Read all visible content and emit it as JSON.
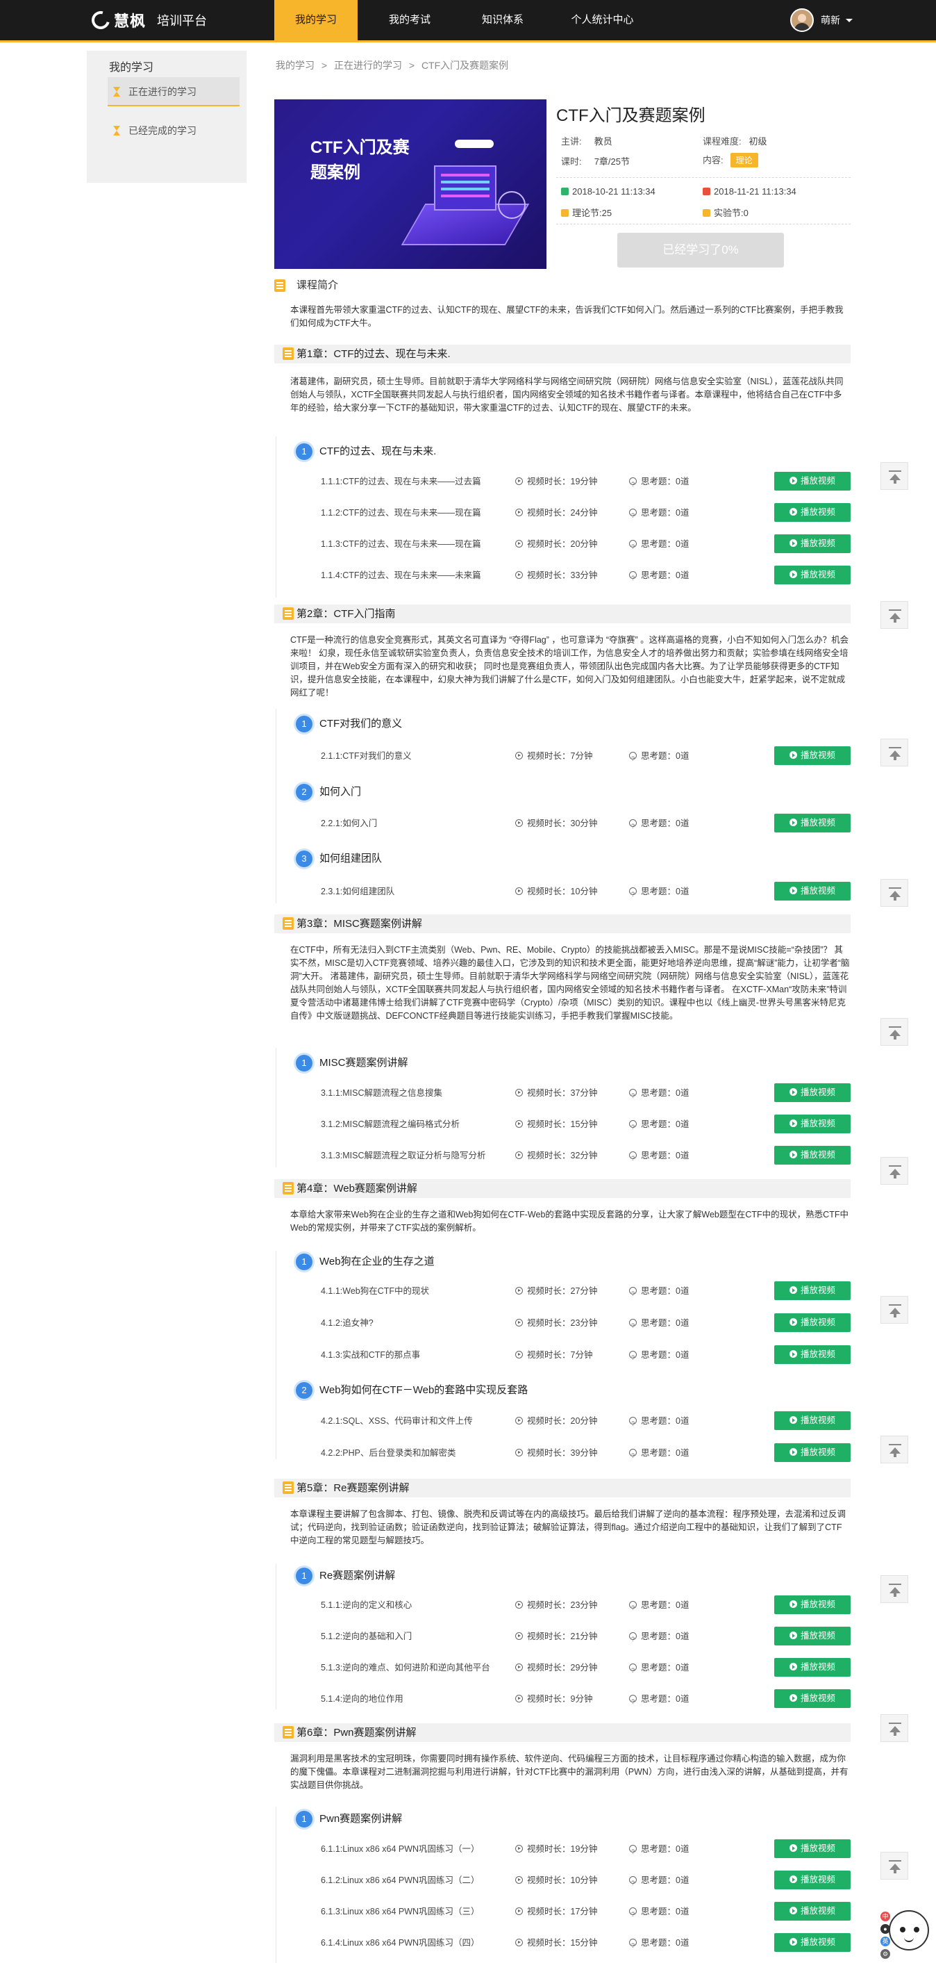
{
  "header": {
    "brand": "慧枫",
    "platform": "培训平台",
    "nav": [
      "我的学习",
      "我的考试",
      "知识体系",
      "个人统计中心"
    ],
    "active_nav": "我的学习",
    "user_name": "萌新"
  },
  "sidebar": {
    "title": "我的学习",
    "items": [
      "正在进行的学习",
      "已经完成的学习"
    ]
  },
  "breadcrumb": [
    "我的学习",
    ">",
    "正在进行的学习",
    ">",
    "CTF入门及赛题案例"
  ],
  "course": {
    "banner_title": "CTF入门及赛题案例",
    "title": "CTF入门及赛题案例",
    "lecturer_label": "主讲:",
    "lecturer": "教员",
    "difficulty_label": "课程难度:",
    "difficulty": "初级",
    "hours_label": "课时:",
    "hours": "7章/25节",
    "content_label": "内容:",
    "content": "理论",
    "start_date": "2018-10-21 11:13:34",
    "end_date": "2018-11-21 11:13:34",
    "theory": "理论节:25",
    "lab": "实验节:0",
    "studied_button": "已经学习了0%",
    "intro_heading": "课程简介",
    "intro": "本课程首先带领大家重温CTF的过去、认知CTF的现在、展望CTF的未来，告诉我们CTF如何入门。然后通过一系列的CTF比赛案例，手把手教我们如何成为CTF大牛。"
  },
  "labels": {
    "video_prefix": "视频时长：",
    "think_prefix": "思考题：",
    "play": "播放视频"
  },
  "chapters": [
    {
      "title": "第1章：CTF的过去、现在与未来.",
      "desc": "渚葛建伟，副研究员，硕士生导师。目前就职于清华大学网络科学与网络空间研究院（网研院）网络与信息安全实验室（NISL），蓝莲花战队共同创始人与领队，XCTF全国联赛共同发起人与执行组织者，国内网络安全领域的知名技术书籍作者与译者。本章课程中，他将结合自己在CTF中多年的经验，给大家分享一下CTF的基础知识，带大家重温CTF的过去、认知CTF的现在、展望CTF的未来。",
      "sections": [
        {
          "num": "1",
          "title": "CTF的过去、现在与未来.",
          "lessons": [
            {
              "name": "1.1.1:CTF的过去、现在与未来——过去篇",
              "video": "19分钟",
              "think": "0道"
            },
            {
              "name": "1.1.2:CTF的过去、现在与未来——现在篇",
              "video": "24分钟",
              "think": "0道"
            },
            {
              "name": "1.1.3:CTF的过去、现在与未来——现在篇",
              "video": "20分钟",
              "think": "0道"
            },
            {
              "name": "1.1.4:CTF的过去、现在与未来——未来篇",
              "video": "33分钟",
              "think": "0道"
            }
          ]
        }
      ]
    },
    {
      "title": "第2章：CTF入门指南",
      "desc": "CTF是一种流行的信息安全竞赛形式，其英文名可直译为 “夺得Flag” ，也可意译为 “夺旗赛” 。这样高逼格的竞赛，小白不知如何入门怎么办？机会来啦！ 幻泉，现任永信至诚软研实验室负责人，负责信息安全技术的培训工作，为信息安全人才的培养做出努力和贡献；实验参填在线网络安全培训项目，并在Web安全方面有深入的研究和收获； 同时也是竞赛组负责人，带领团队出色完成国内各大比赛。为了让学员能够获得更多的CTF知识，提升信息安全技能，在本课程中，幻泉大神为我们讲解了什么是CTF，如何入门及如何组建团队。小白也能变大牛，赶紧学起来，说不定就成网红了呢！",
      "sections": [
        {
          "num": "1",
          "title": "CTF对我们的意义",
          "lessons": [
            {
              "name": "2.1.1:CTF对我们的意义",
              "video": "7分钟",
              "think": "0道"
            }
          ]
        },
        {
          "num": "2",
          "title": "如何入门",
          "lessons": [
            {
              "name": "2.2.1:如何入门",
              "video": "30分钟",
              "think": "0道"
            }
          ]
        },
        {
          "num": "3",
          "title": "如何组建团队",
          "lessons": [
            {
              "name": "2.3.1:如何组建团队",
              "video": "10分钟",
              "think": "0道"
            }
          ]
        }
      ]
    },
    {
      "title": "第3章：MISC赛题案例讲解",
      "desc": "在CTF中，所有无法归入到CTF主流类别（Web、Pwn、RE、Mobile、Crypto）的技能挑战都被丢入MISC。那是不是说MISC技能=“杂技团”？ 其实不然，MISC是切入CTF竞赛领域、培养兴趣的最佳入口，它涉及到的知识和技术更全面，能更好地培养逆向思维，提高“解谜”能力，让初学者“脑洞”大开。 渚葛建伟，副研究员，硕士生导师。目前就职于清华大学网络科学与网络空间研究院（网研院）网络与信息安全实验室（NISL），蓝莲花战队共同创始人与领队，XCTF全国联赛共同发起人与执行组织者，国内网络安全领域的知名技术书籍作者与译者。 在XCTF-XMan“攻防未来”特训夏令营活动中诸葛建伟博士给我们讲解了CTF竞赛中密码学（Crypto）/杂项（MISC）类别的知识。课程中也以《线上幽灵-世界头号黑客米特尼克自传》中文版谜题挑战、DEFCONCTF经典题目等进行技能实训练习，手把手教我们掌握MISC技能。",
      "sections": [
        {
          "num": "1",
          "title": "MISC赛题案例讲解",
          "lessons": [
            {
              "name": "3.1.1:MISC解题流程之信息搜集",
              "video": "37分钟",
              "think": "0道"
            },
            {
              "name": "3.1.2:MISC解题流程之编码格式分析",
              "video": "15分钟",
              "think": "0道"
            },
            {
              "name": "3.1.3:MISC解题流程之取证分析与隐写分析",
              "video": "32分钟",
              "think": "0道"
            }
          ]
        }
      ]
    },
    {
      "title": "第4章：Web赛题案例讲解",
      "desc": "本章给大家带来Web狗在企业的生存之道和Web狗如何在CTF-Web的套路中实现反套路的分享，让大家了解Web题型在CTF中的现状，熟悉CTF中 Web的常规实例，并带来了CTF实战的案例解析。",
      "sections": [
        {
          "num": "1",
          "title": "Web狗在企业的生存之道",
          "lessons": [
            {
              "name": "4.1.1:Web狗在CTF中的现状",
              "video": "27分钟",
              "think": "0道"
            },
            {
              "name": "4.1.2:追女神?",
              "video": "23分钟",
              "think": "0道"
            },
            {
              "name": "4.1.3:实战和CTF的那点事",
              "video": "7分钟",
              "think": "0道"
            }
          ]
        },
        {
          "num": "2",
          "title": "Web狗如何在CTF－Web的套路中实现反套路",
          "lessons": [
            {
              "name": "4.2.1:SQL、XSS、代码审计和文件上传",
              "video": "20分钟",
              "think": "0道"
            },
            {
              "name": "4.2.2:PHP、后台登录类和加解密类",
              "video": "39分钟",
              "think": "0道"
            }
          ]
        }
      ]
    },
    {
      "title": "第5章：Re赛题案例讲解",
      "desc": "本章课程主要讲解了包含脚本、打包、镜像、脱壳和反调试等在内的高级技巧。最后给我们讲解了逆向的基本流程：程序预处理，去混淆和过反调试；代码逆向，找到验证函数；验证函数逆向，找到验证算法；破解验证算法，得到flag。通过介绍逆向工程中的基础知识，让我们了解到了CTF中逆向工程的常见题型与解题技巧。",
      "sections": [
        {
          "num": "1",
          "title": "Re赛题案例讲解",
          "lessons": [
            {
              "name": "5.1.1:逆向的定义和核心",
              "video": "23分钟",
              "think": "0道"
            },
            {
              "name": "5.1.2:逆向的基础和入门",
              "video": "21分钟",
              "think": "0道"
            },
            {
              "name": "5.1.3:逆向的难点、如何进阶和逆向其他平台",
              "video": "29分钟",
              "think": "0道"
            },
            {
              "name": "5.1.4:逆向的地位作用",
              "video": "9分钟",
              "think": "0道"
            }
          ]
        }
      ]
    },
    {
      "title": "第6章：Pwn赛题案例讲解",
      "desc": "漏洞利用是黑客技术的宝冠明珠，你需要同时拥有操作系统、软件逆向、代码编程三方面的技术，让目标程序通过你精心构造的输入数据，成为你的魔下傀儡。本章课程对二进制漏洞挖掘与利用进行讲解，针对CTF比赛中的漏洞利用（PWN）方向，进行由浅入深的讲解，从基础到提高，并有实战题目供你挑战。",
      "sections": [
        {
          "num": "1",
          "title": "Pwn赛题案例讲解",
          "lessons": [
            {
              "name": "6.1.1:Linux x86 x64 PWN巩固练习（一）",
              "video": "19分钟",
              "think": "0道"
            },
            {
              "name": "6.1.2:Linux x86 x64 PWN巩固练习（二）",
              "video": "10分钟",
              "think": "0道"
            },
            {
              "name": "6.1.3:Linux x86 x64 PWN巩固练习（三）",
              "video": "17分钟",
              "think": "0道"
            },
            {
              "name": "6.1.4:Linux x86 x64 PWN巩固练习（四）",
              "video": "15分钟",
              "think": "0道"
            }
          ]
        }
      ]
    }
  ],
  "assistant": {
    "tags": [
      "中",
      "●",
      "英",
      "⚙"
    ]
  }
}
